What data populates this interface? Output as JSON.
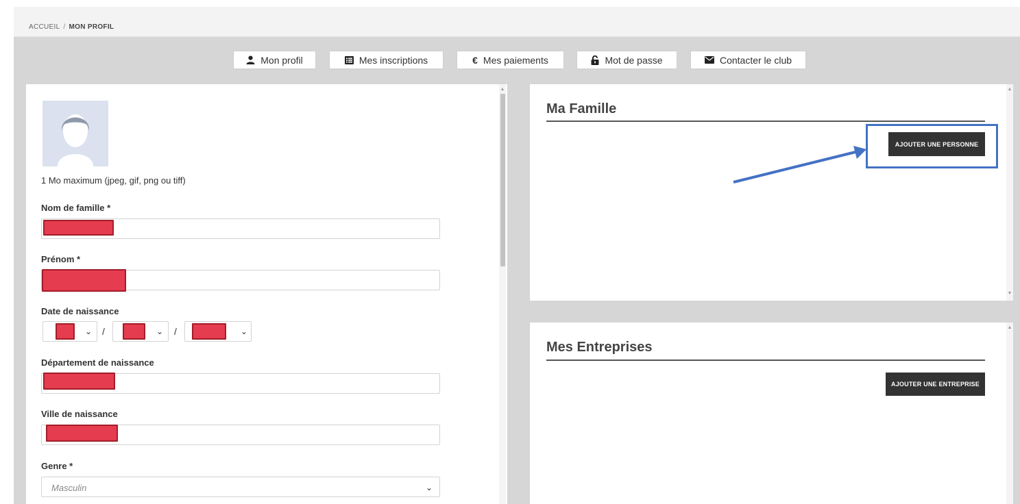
{
  "breadcrumb": {
    "home": "ACCUEIL",
    "separator": "/",
    "current": "MON PROFIL"
  },
  "tabs": [
    {
      "label": "Mon profil",
      "icon": "user-icon"
    },
    {
      "label": "Mes inscriptions",
      "icon": "list-icon"
    },
    {
      "label": "Mes paiements",
      "icon": "euro-icon"
    },
    {
      "label": "Mot de passe",
      "icon": "lock-icon"
    },
    {
      "label": "Contacter le club",
      "icon": "envelope-icon"
    }
  ],
  "profile": {
    "avatar_icon": "avatar-placeholder-icon",
    "photo_hint": "1 Mo maximum (jpeg, gif, png ou tiff)",
    "last_name_label": "Nom de famille *",
    "first_name_label": "Prénom *",
    "birth_date_label": "Date de naissance",
    "date_separator": "/",
    "birth_department_label": "Département de naissance",
    "birth_city_label": "Ville de naissance",
    "gender_label": "Genre *",
    "gender_value": "Masculin"
  },
  "family": {
    "title": "Ma Famille",
    "add_button": "AJOUTER UNE PERSONNE"
  },
  "companies": {
    "title": "Mes Entreprises",
    "add_button": "AJOUTER UNE ENTREPRISE"
  },
  "colors": {
    "redaction": "#e53c4f",
    "annotation": "#4472c4",
    "button": "#333333"
  }
}
